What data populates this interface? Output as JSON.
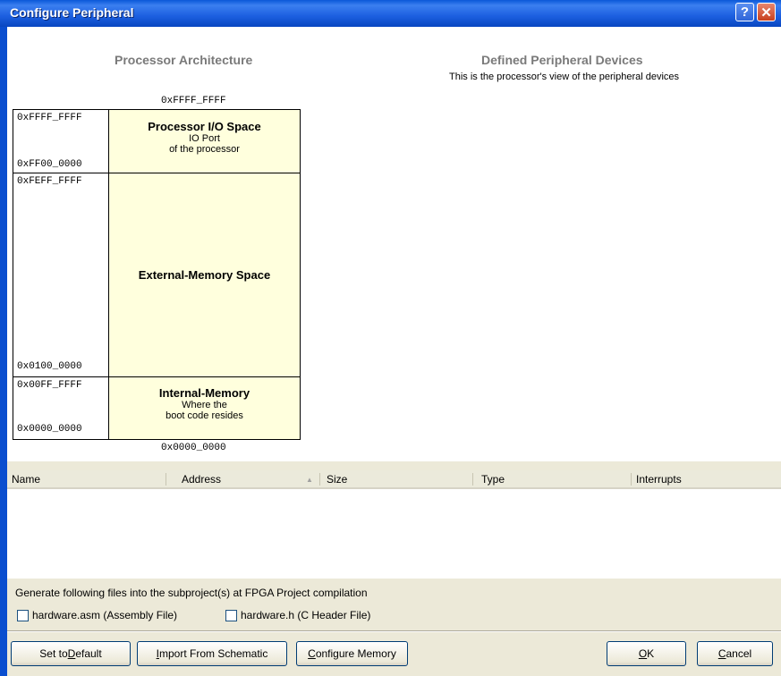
{
  "window": {
    "title": "Configure Peripheral"
  },
  "arch": {
    "title": "Processor Architecture",
    "top_address": "0xFFFF_FFFF",
    "bottom_address": "0x0000_0000",
    "regions": [
      {
        "name": "Processor I/O Space",
        "desc1": "IO Port",
        "desc2": "of the processor",
        "addr_high": "0xFFFF_FFFF",
        "addr_low": "0xFF00_0000"
      },
      {
        "name": "External-Memory Space",
        "desc1": "",
        "desc2": "",
        "addr_high": "0xFEFF_FFFF",
        "addr_low": "0x0100_0000"
      },
      {
        "name": "Internal-Memory",
        "desc1": "Where the",
        "desc2": "boot code resides",
        "addr_high": "0x00FF_FFFF",
        "addr_low": "0x0000_0000"
      }
    ]
  },
  "devices": {
    "title": "Defined Peripheral Devices",
    "subtitle": "This is the processor's view of the peripheral devices"
  },
  "grid": {
    "columns": [
      "Name",
      "Address",
      "Size",
      "Type",
      "Interrupts"
    ],
    "sort_indicator": "▲",
    "rows": []
  },
  "generate": {
    "text": "Generate following files into the subproject(s) at FPGA Project compilation",
    "asm_label": "hardware.asm (Assembly File)",
    "asm_checked": false,
    "h_label": "hardware.h (C Header File)",
    "h_checked": false
  },
  "buttons": {
    "set_default_pre": "Set to ",
    "set_default_key": "D",
    "set_default_post": "efault",
    "import_key": "I",
    "import_post": "mport From Schematic",
    "configure_key": "C",
    "configure_post": "onfigure Memory",
    "ok_key": "O",
    "ok_post": "K",
    "cancel_key": "C",
    "cancel_post": "ancel"
  },
  "colors": {
    "title_bar": "#0a58d8",
    "region_fill": "#ffffdd",
    "dialog_bg": "#ece9d8"
  }
}
